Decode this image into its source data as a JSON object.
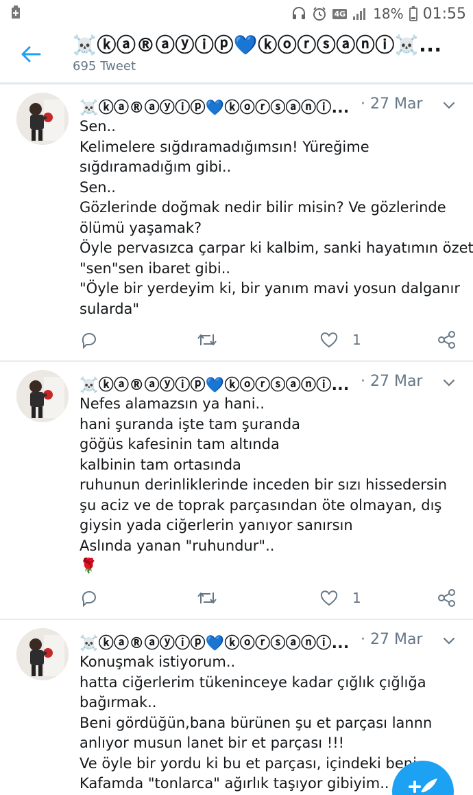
{
  "statusbar": {
    "network": "4G",
    "battery": "18%",
    "time": "01:55"
  },
  "header": {
    "title": "☠️ⓚⓐ®ⓐⓨⓘⓟ💙ⓚⓞⓡⓢⓐⓝⓘ☠️...",
    "tweet_count": "695 Tweet"
  },
  "colors": {
    "accent": "#1da1f2",
    "text": "#14171a",
    "secondary": "#657786",
    "divider": "#e6ecf0"
  },
  "tweets": [
    {
      "name": "☠️ⓚⓐ®ⓐⓨⓘⓟ💙ⓚⓞⓡⓢⓐⓝⓘ...",
      "date": "· 27 Mar",
      "lines": [
        "Sen..",
        "Kelimelere sığdıramadığımsın! Yüreğime",
        "sığdıramadığım gibi..",
        "Sen..",
        "Gözlerinde doğmak nedir bilir misin? Ve gözlerinde",
        "ölümü yaşamak?",
        "Öyle pervasızca çarpar ki kalbim, sanki hayatımın özeti",
        "\"sen\"sen ibaret gibi..",
        "\"Öyle bir yerdeyim ki, bir yanım mavi yosun dalganır",
        "sularda\""
      ],
      "likes": "1"
    },
    {
      "name": "☠️ⓚⓐ®ⓐⓨⓘⓟ💙ⓚⓞⓡⓢⓐⓝⓘ...",
      "date": "· 27 Mar",
      "lines": [
        "Nefes alamazsın ya hani..",
        "hani şuranda işte tam şuranda",
        "göğüs kafesinin tam altında",
        "kalbinin tam ortasında",
        "ruhunun derinliklerinde inceden bir sızı hissedersin",
        "şu aciz ve de toprak parçasından öte olmayan, dış",
        "giysin yada ciğerlerin yanıyor sanırsın",
        "Aslında yanan \"ruhundur\"..",
        "🌹"
      ],
      "likes": "1"
    },
    {
      "name": "☠️ⓚⓐ®ⓐⓨⓘⓟ💙ⓚⓞⓡⓢⓐⓝⓘ...",
      "date": "· 27 Mar",
      "lines": [
        "Konuşmak istiyorum..",
        "hatta ciğerlerim tükeninceye kadar çığlık çığlığa",
        "bağırmak..",
        "Beni gördüğün,bana bürünen şu et parçası lannn",
        "anlıyor musun lanet bir et parçası !!!",
        "Ve öyle bir yordu ki bu et parçası, içindeki beni.",
        "Kafamda \"tonlarca\" ağırlık taşıyor gibiyim.."
      ],
      "likes": ""
    }
  ],
  "icons": {
    "back": "arrow-left-icon",
    "reply": "reply-icon",
    "retweet": "retweet-icon",
    "like": "heart-icon",
    "share": "share-icon",
    "caret": "chevron-down-icon",
    "compose": "compose-icon"
  }
}
